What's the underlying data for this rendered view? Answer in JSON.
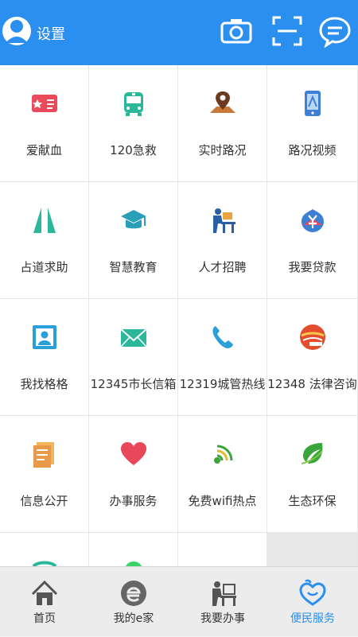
{
  "header": {
    "settings_label": "设置",
    "icons": [
      "avatar-icon",
      "camera-icon",
      "scan-icon",
      "message-icon"
    ],
    "bg_color": "#2b8ff0"
  },
  "services": [
    {
      "label": "爱献血",
      "icon": "blood-donation-icon"
    },
    {
      "label": "120急救",
      "icon": "ambulance-icon"
    },
    {
      "label": "实时路况",
      "icon": "map-pin-icon"
    },
    {
      "label": "路况视频",
      "icon": "traffic-video-icon"
    },
    {
      "label": "占道求助",
      "icon": "road-icon"
    },
    {
      "label": "智慧教育",
      "icon": "graduation-cap-icon"
    },
    {
      "label": "人才招聘",
      "icon": "recruit-icon"
    },
    {
      "label": "我要贷款",
      "icon": "loan-icon"
    },
    {
      "label": "我找格格",
      "icon": "contact-icon"
    },
    {
      "label": "12345市长信箱",
      "icon": "mail-icon"
    },
    {
      "label": "12319城管热线",
      "icon": "phone-icon"
    },
    {
      "label": "12348 法律咨询",
      "icon": "legal-icon"
    },
    {
      "label": "信息公开",
      "icon": "document-icon"
    },
    {
      "label": "办事服务",
      "icon": "heart-icon"
    },
    {
      "label": "免费wifi热点",
      "icon": "wifi-icon"
    },
    {
      "label": "生态环保",
      "icon": "eco-leaf-icon"
    }
  ],
  "tabs": [
    {
      "label": "首页",
      "icon": "home-icon"
    },
    {
      "label": "我的e家",
      "icon": "e-home-icon"
    },
    {
      "label": "我要办事",
      "icon": "office-icon"
    },
    {
      "label": "便民服务",
      "icon": "service-icon"
    }
  ],
  "active_tab": 3
}
